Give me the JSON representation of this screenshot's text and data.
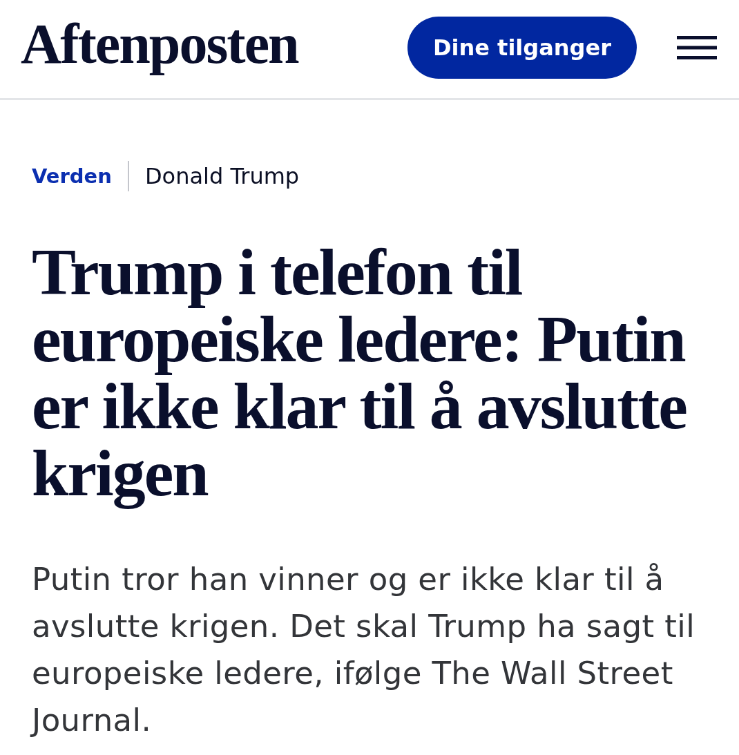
{
  "header": {
    "logo": "Aftenposten",
    "access_button": "Dine tilganger"
  },
  "breadcrumb": {
    "section": "Verden",
    "topic": "Donald Trump"
  },
  "headline": "Trump i telefon til europeiske ledere: Putin er ikke klar til å avslutte krigen",
  "lead": "Putin tror han vinner og er ikke klar til å avslutte krigen. Det skal Trump ha sagt til europeiske ledere, ifølge The Wall Street Journal."
}
